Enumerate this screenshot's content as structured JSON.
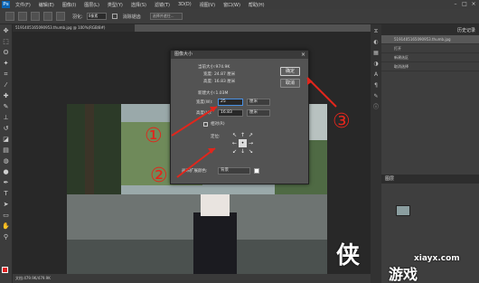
{
  "app": {
    "logo": "Ps"
  },
  "menubar": [
    "文件(F)",
    "编辑(E)",
    "图像(I)",
    "图层(L)",
    "类型(Y)",
    "选择(S)",
    "滤镜(T)",
    "3D(D)",
    "视图(V)",
    "窗口(W)",
    "帮助(H)"
  ],
  "options": {
    "feather_label": "羽化:",
    "feather_value": "0像素",
    "antialias_label": "消除锯齿",
    "style_value": "选择并遮住..."
  },
  "document": {
    "tab_title": "5191405165090953.thumb.jpg @ 100%(RGB/8#)",
    "status": "文档:479.9K/479.9K"
  },
  "dialog": {
    "title": "图像大小",
    "current_size": "当前大小:974.9K",
    "current_width": "宽度: 24.87 厘米",
    "current_height": "高度: 16.83 厘米",
    "new_size": "新建大小:1.03M",
    "width_label": "宽度(W):",
    "width_value": "25",
    "width_unit": "厘米",
    "height_label": "高度(H):",
    "height_value": "16.83",
    "height_unit": "厘米",
    "relative_label": "相对(R)",
    "anchor_label": "定位:",
    "ext_color_label": "画布扩展颜色:",
    "ext_color_value": "背景",
    "ok": "确定",
    "cancel": "取消"
  },
  "callouts": [
    "①",
    "②",
    "③"
  ],
  "panel": {
    "tab": "历史记录",
    "history": [
      "5191405165090953.thumb.jpg",
      "打开",
      "新建选区",
      "取消选择"
    ],
    "layers_tab": "图层"
  },
  "watermark": {
    "glyph": "侠",
    "site": "xiayx.com",
    "brand": "游戏"
  },
  "colors": {
    "accent": "#e1261c",
    "foreground_swatch": "#e02020",
    "background_swatch": "#111111"
  }
}
